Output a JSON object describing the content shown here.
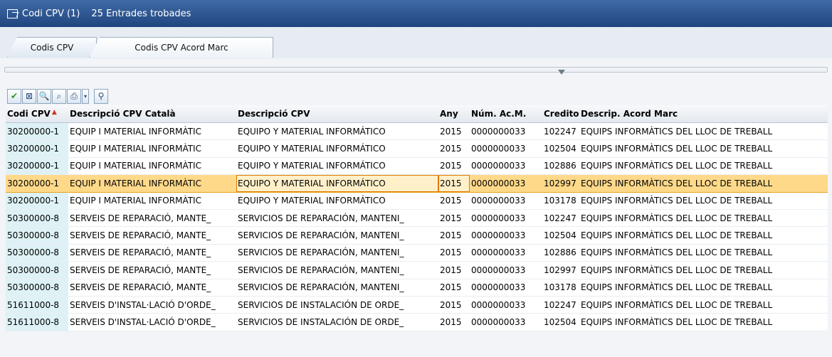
{
  "window": {
    "title": "Codi CPV (1)",
    "count": "25 Entrades trobades"
  },
  "tabs": [
    {
      "label": "Codis CPV"
    },
    {
      "label": "Codis CPV Acord Marc"
    }
  ],
  "toolbar": {
    "icons": [
      "check-icon",
      "table-view-icon",
      "find-icon",
      "find-next-icon",
      "print-icon",
      "dropdown-icon",
      "hierarchy-icon"
    ]
  },
  "table": {
    "headers": [
      "Codi CPV",
      "Descripció CPV Català",
      "Descripció CPV",
      "Any",
      "Núm. Ac.M.",
      "Creditor",
      "Descrip. Acord Marc"
    ],
    "rows": [
      [
        "30200000-1",
        "EQUIP I MATERIAL INFORMÀTIC",
        "EQUIPO Y MATERIAL INFORMÁTICO",
        "2015",
        "0000000033",
        "102247",
        "EQUIPS INFORMÀTICS DEL LLOC DE TREBALL"
      ],
      [
        "30200000-1",
        "EQUIP I MATERIAL INFORMÀTIC",
        "EQUIPO Y MATERIAL INFORMÁTICO",
        "2015",
        "0000000033",
        "102504",
        "EQUIPS INFORMÀTICS DEL LLOC DE TREBALL"
      ],
      [
        "30200000-1",
        "EQUIP I MATERIAL INFORMÀTIC",
        "EQUIPO Y MATERIAL INFORMÁTICO",
        "2015",
        "0000000033",
        "102886",
        "EQUIPS INFORMÀTICS DEL LLOC DE TREBALL"
      ],
      [
        "30200000-1",
        "EQUIP I MATERIAL INFORMÀTIC",
        "EQUIPO Y MATERIAL INFORMÁTICO",
        "2015",
        "0000000033",
        "102997",
        "EQUIPS INFORMÀTICS DEL LLOC DE TREBALL"
      ],
      [
        "30200000-1",
        "EQUIP I MATERIAL INFORMÀTIC",
        "EQUIPO Y MATERIAL INFORMÁTICO",
        "2015",
        "0000000033",
        "103178",
        "EQUIPS INFORMÀTICS DEL LLOC DE TREBALL"
      ],
      [
        "50300000-8",
        "SERVEIS DE REPARACIÓ, MANTE_",
        "SERVICIOS DE REPARACIÓN, MANTENI_",
        "2015",
        "0000000033",
        "102247",
        "EQUIPS INFORMÀTICS DEL LLOC DE TREBALL"
      ],
      [
        "50300000-8",
        "SERVEIS DE REPARACIÓ, MANTE_",
        "SERVICIOS DE REPARACIÓN, MANTENI_",
        "2015",
        "0000000033",
        "102504",
        "EQUIPS INFORMÀTICS DEL LLOC DE TREBALL"
      ],
      [
        "50300000-8",
        "SERVEIS DE REPARACIÓ, MANTE_",
        "SERVICIOS DE REPARACIÓN, MANTENI_",
        "2015",
        "0000000033",
        "102886",
        "EQUIPS INFORMÀTICS DEL LLOC DE TREBALL"
      ],
      [
        "50300000-8",
        "SERVEIS DE REPARACIÓ, MANTE_",
        "SERVICIOS DE REPARACIÓN, MANTENI_",
        "2015",
        "0000000033",
        "102997",
        "EQUIPS INFORMÀTICS DEL LLOC DE TREBALL"
      ],
      [
        "50300000-8",
        "SERVEIS DE REPARACIÓ, MANTE_",
        "SERVICIOS DE REPARACIÓN, MANTENI_",
        "2015",
        "0000000033",
        "103178",
        "EQUIPS INFORMÀTICS DEL LLOC DE TREBALL"
      ],
      [
        "51611000-8",
        "SERVEIS D'INSTAL·LACIÓ D'ORDE_",
        "SERVICIOS DE INSTALACIÓN DE ORDE_",
        "2015",
        "0000000033",
        "102247",
        "EQUIPS INFORMÀTICS DEL LLOC DE TREBALL"
      ],
      [
        "51611000-8",
        "SERVEIS D'INSTAL·LACIÓ D'ORDE_",
        "SERVICIOS DE INSTALACIÓN DE ORDE_",
        "2015",
        "0000000033",
        "102504",
        "EQUIPS INFORMÀTICS DEL LLOC DE TREBALL"
      ]
    ]
  },
  "colors": {
    "selected_row": "#ffd98a",
    "key_column": "#def2f6",
    "title_bar": "#2b5189"
  }
}
